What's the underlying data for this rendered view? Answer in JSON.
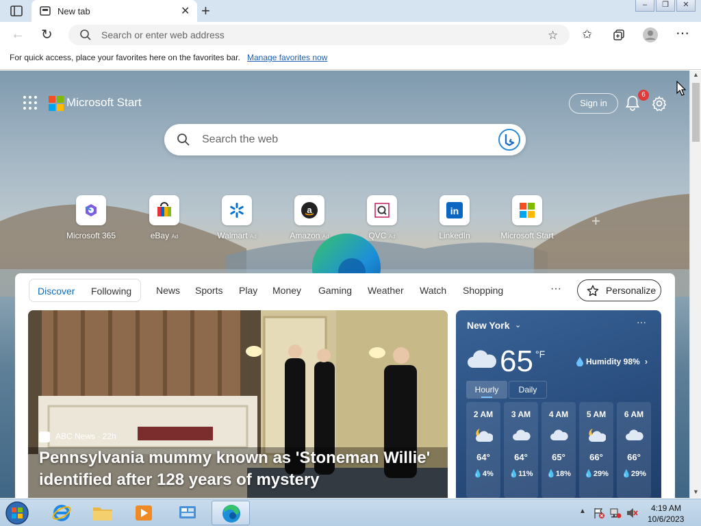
{
  "browser": {
    "tab_title": "New tab",
    "tab_close": "✕",
    "new_tab": "+",
    "address_placeholder": "Search or enter web address",
    "window_controls": [
      "–",
      "❐",
      "✕"
    ],
    "favorites_message": "For quick access, place your favorites here on the favorites bar.",
    "favorites_link": "Manage favorites now",
    "toolbar_icons": [
      "add-favorite-icon",
      "favorites-icon",
      "collections-icon",
      "profile-icon",
      "more-icon"
    ]
  },
  "start": {
    "brand": "Microsoft Start",
    "sign_in": "Sign in",
    "notification_count": "6",
    "search_placeholder": "Search the web",
    "tiles": [
      {
        "label": "Microsoft 365",
        "ad": ""
      },
      {
        "label": "eBay",
        "ad": "Ad"
      },
      {
        "label": "Walmart",
        "ad": "Ad"
      },
      {
        "label": "Amazon",
        "ad": "Ad"
      },
      {
        "label": "QVC",
        "ad": "Ad"
      },
      {
        "label": "LinkedIn",
        "ad": ""
      },
      {
        "label": "Microsoft Start",
        "ad": ""
      }
    ],
    "add_site": "+"
  },
  "feed": {
    "tabs": {
      "discover": "Discover",
      "following": "Following"
    },
    "nav": [
      "News",
      "Sports",
      "Play",
      "Money",
      "Gaming",
      "Weather",
      "Watch",
      "Shopping"
    ],
    "more": "···",
    "personalize": "Personalize",
    "hero": {
      "source": "ABC News · 22h",
      "title": "Pennsylvania mummy known as 'Stoneman Willie' identified after 128 years of mystery"
    }
  },
  "weather": {
    "city": "New York",
    "temp": "65",
    "unit": "°F",
    "humidity": "Humidity 98%",
    "hourly_tab": "Hourly",
    "daily_tab": "Daily",
    "hours": [
      {
        "time": "2 AM",
        "icon": "partly-cloudy-night-icon",
        "temp": "64°",
        "precip": "4%"
      },
      {
        "time": "3 AM",
        "icon": "cloud-icon",
        "temp": "64°",
        "precip": "11%"
      },
      {
        "time": "4 AM",
        "icon": "cloud-icon",
        "temp": "65°",
        "precip": "18%"
      },
      {
        "time": "5 AM",
        "icon": "partly-cloudy-night-icon",
        "temp": "66°",
        "precip": "29%"
      },
      {
        "time": "6 AM",
        "icon": "cloud-icon",
        "temp": "66°",
        "precip": "29%"
      }
    ]
  },
  "taskbar": {
    "time": "4:19 AM",
    "date": "10/6/2023",
    "tray_arrow": "▲"
  },
  "colors": {
    "accent": "#0f6cbd",
    "badge": "#e03a3a",
    "weather_bg": "#2a4f80"
  }
}
